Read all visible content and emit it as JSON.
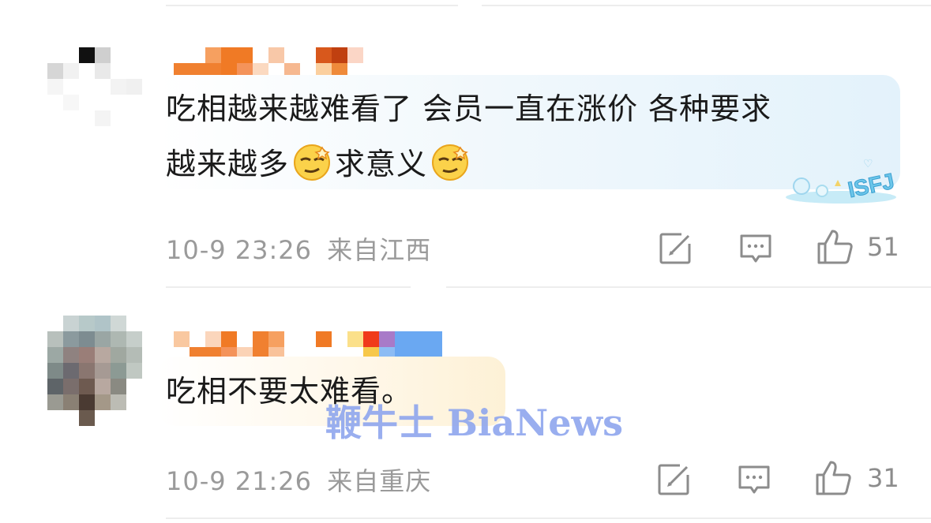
{
  "comments": [
    {
      "text_line1": "吃相越来越难看了 会员一直在涨价 各种要求",
      "text_line2_a": "越来越多",
      "text_line2_b": "求意义",
      "date": "10-9 23:26",
      "location": "来自江西",
      "likes": "51",
      "icons": [
        "share-icon",
        "comment-icon",
        "thumbs-up-icon"
      ],
      "bubble_badge": "ISFJ"
    },
    {
      "text": "吃相不要太难看。",
      "date": "10-9 21:26",
      "location": "来自重庆",
      "likes": "31",
      "icons": [
        "share-icon",
        "comment-icon",
        "thumbs-up-icon"
      ]
    }
  ],
  "watermark": "鞭牛士 BiaNews",
  "colors": {
    "meta_text": "#9a9a9a",
    "watermark": "#8fa6ee"
  }
}
